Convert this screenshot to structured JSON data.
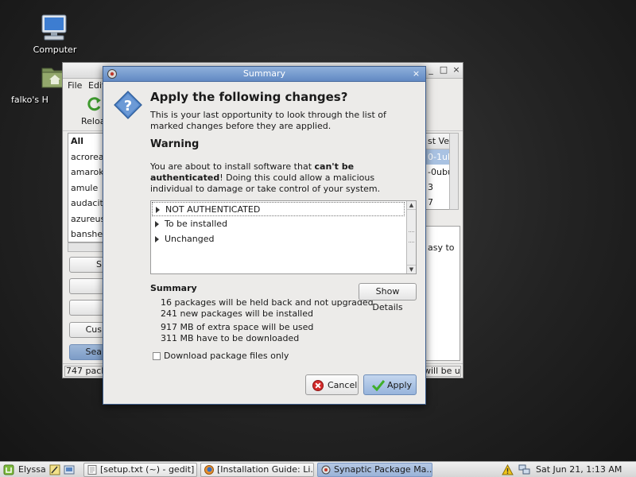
{
  "desktop": {
    "computer_label": "Computer",
    "home_label": "falko's H"
  },
  "background_window": {
    "menu_file": "File",
    "menu_edit": "Edit",
    "reload_label": "Reloa",
    "packages": [
      "All",
      "acroread",
      "amarok",
      "amule",
      "audacity",
      "azureus",
      "banshee"
    ],
    "button_partial_1": "S",
    "button_partial_custom": "Cus",
    "button_partial_search": "Sea",
    "version_header": "st Ver",
    "versions": [
      "0-1ub",
      "-0ubu",
      "3",
      "7"
    ],
    "desc_fragment": "asy to",
    "status_left": "747 packa",
    "status_right": "will be us"
  },
  "dialog": {
    "title": "Summary",
    "heading": "Apply the following changes?",
    "intro": "This is your last opportunity to look through the list of marked changes before they are applied.",
    "warning_heading": "Warning",
    "warning_pre": "You are about to install software that ",
    "warning_bold": "can't be authenticated",
    "warning_post": "! Doing this could allow a malicious individual to damage or take control of your system.",
    "tree_items": [
      "NOT AUTHENTICATED",
      "To be installed",
      "Unchanged"
    ],
    "summary_heading": "Summary",
    "summary_lines": [
      "16 packages will be held back and not upgraded",
      "241 new packages will be installed",
      "917 MB of extra space will be used",
      "311 MB have to be downloaded"
    ],
    "show_details_label": "Show Details",
    "download_only_label": "Download package files only",
    "cancel_label": "Cancel",
    "apply_label": "Apply"
  },
  "taskbar": {
    "menu_label": "Elyssa",
    "tasks": [
      "[setup.txt (~) - gedit]",
      "[Installation Guide: Li...",
      "Synaptic Package Ma..."
    ],
    "clock": "Sat Jun 21,  1:13 AM"
  },
  "colors": {
    "title_blue": "#6189c3",
    "selection": "#a9c2e2"
  }
}
